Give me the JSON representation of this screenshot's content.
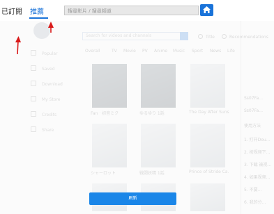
{
  "tabs": {
    "subscribed": "已訂閱",
    "recommended": "推薦"
  },
  "search": {
    "placeholder": "搜尋影片 / 搜尋頻道"
  },
  "icons": {
    "home": "home-icon"
  },
  "background": {
    "sidebar": [
      "Popular",
      "Saved",
      "Download",
      "My Store",
      "Credits",
      "Share"
    ],
    "search_text": "Search for videos and channels",
    "radios": [
      "Title",
      "Recommendations"
    ],
    "categories": [
      "Overall",
      "TV",
      "Movie",
      "PV",
      "Anime",
      "Music",
      "Sport",
      "News",
      "Life"
    ],
    "thumbnails": [
      {
        "caption": "Fan · 初音ミク"
      },
      {
        "caption": "ゆるゆり 1話"
      },
      {
        "caption": "The Day After Sunset"
      },
      {
        "caption": "シャーロット"
      },
      {
        "caption": "戦闘妖精 1話"
      },
      {
        "caption": "Prince of Stride Ca…"
      }
    ],
    "right_panel": [
      "Ss07Fa…",
      "Ss07Fa…",
      "使用方法",
      "1. 打开Dou…",
      "2. 按视频下…",
      "3. 下载 被视…",
      "4. 如果视频…",
      "5. 不要…",
      "6. 我的分…"
    ]
  },
  "refresh_button": {
    "label": "刷新"
  },
  "colors": {
    "accent": "#1a73d9",
    "button": "#1a86e8",
    "arrow": "#d91a1a"
  }
}
